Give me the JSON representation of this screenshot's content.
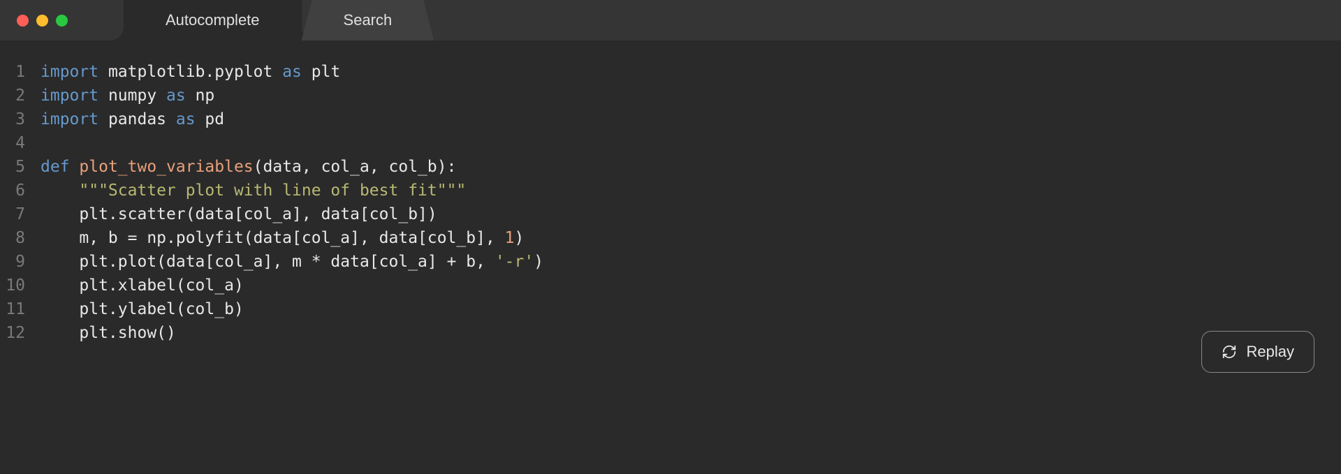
{
  "tabs": {
    "active": "Autocomplete",
    "inactive": "Search"
  },
  "code": {
    "lines": [
      {
        "num": "1",
        "tokens": [
          {
            "t": "import",
            "c": "kw"
          },
          {
            "t": " matplotlib.pyplot ",
            "c": "id"
          },
          {
            "t": "as",
            "c": "kw"
          },
          {
            "t": " plt",
            "c": "id"
          }
        ]
      },
      {
        "num": "2",
        "tokens": [
          {
            "t": "import",
            "c": "kw"
          },
          {
            "t": " numpy ",
            "c": "id"
          },
          {
            "t": "as",
            "c": "kw"
          },
          {
            "t": " np",
            "c": "id"
          }
        ]
      },
      {
        "num": "3",
        "tokens": [
          {
            "t": "import",
            "c": "kw"
          },
          {
            "t": " pandas ",
            "c": "id"
          },
          {
            "t": "as",
            "c": "kw"
          },
          {
            "t": " pd",
            "c": "id"
          }
        ]
      },
      {
        "num": "4",
        "tokens": []
      },
      {
        "num": "5",
        "tokens": [
          {
            "t": "def",
            "c": "kw"
          },
          {
            "t": " ",
            "c": "id"
          },
          {
            "t": "plot_two_variables",
            "c": "fn"
          },
          {
            "t": "(data, col_a, col_b):",
            "c": "punct"
          }
        ]
      },
      {
        "num": "6",
        "tokens": [
          {
            "t": "    ",
            "c": "id"
          },
          {
            "t": "\"\"\"Scatter plot with line of best fit\"\"\"",
            "c": "str"
          }
        ]
      },
      {
        "num": "7",
        "tokens": [
          {
            "t": "    plt.scatter(data[col_a], data[col_b])",
            "c": "id"
          }
        ]
      },
      {
        "num": "8",
        "tokens": [
          {
            "t": "    m, b = np.polyfit(data[col_a], data[col_b], ",
            "c": "id"
          },
          {
            "t": "1",
            "c": "num"
          },
          {
            "t": ")",
            "c": "id"
          }
        ]
      },
      {
        "num": "9",
        "tokens": [
          {
            "t": "    plt.plot(data[col_a], m * data[col_a] + b, ",
            "c": "id"
          },
          {
            "t": "'-r'",
            "c": "str"
          },
          {
            "t": ")",
            "c": "id"
          }
        ]
      },
      {
        "num": "10",
        "tokens": [
          {
            "t": "    plt.xlabel(col_a)",
            "c": "id"
          }
        ]
      },
      {
        "num": "11",
        "tokens": [
          {
            "t": "    plt.ylabel(col_b)",
            "c": "id"
          }
        ]
      },
      {
        "num": "12",
        "tokens": [
          {
            "t": "    plt.show()",
            "c": "id"
          }
        ]
      }
    ]
  },
  "replay_label": "Replay"
}
